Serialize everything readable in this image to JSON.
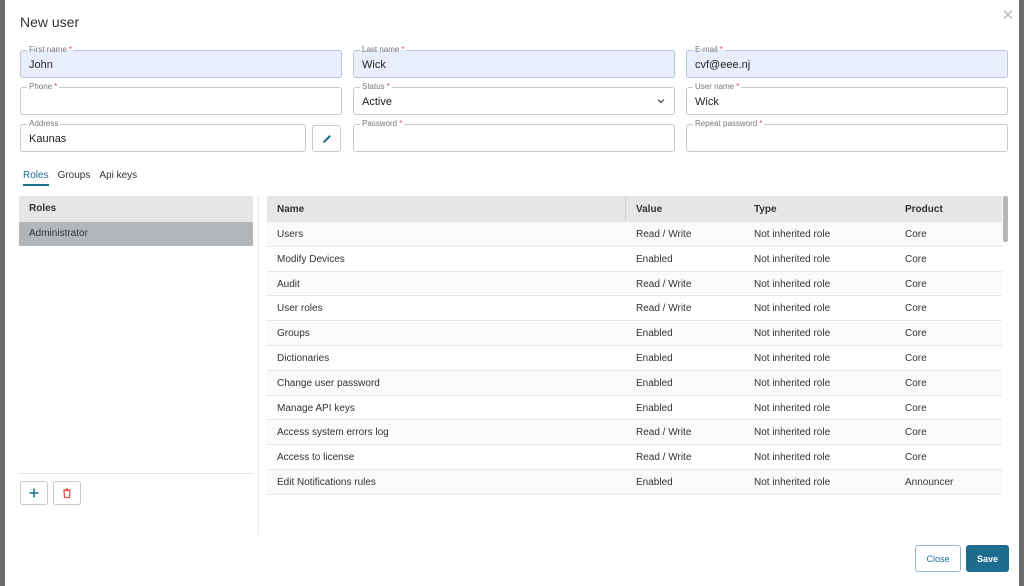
{
  "dialog": {
    "title": "New user"
  },
  "fields": {
    "first_name": {
      "label": "First name",
      "required": "*",
      "value": "John"
    },
    "last_name": {
      "label": "Last name",
      "required": "*",
      "value": "Wick"
    },
    "email": {
      "label": "E-mail",
      "required": "*",
      "value": "cvf@eee.nj"
    },
    "phone": {
      "label": "Phone",
      "required": "*",
      "value": ""
    },
    "status": {
      "label": "Status",
      "required": "*",
      "value": "Active"
    },
    "user_name": {
      "label": "User name",
      "required": "*",
      "value": "Wick"
    },
    "address": {
      "label": "Address",
      "value": "Kaunas"
    },
    "password": {
      "label": "Password",
      "required": "*",
      "value": ""
    },
    "repeat_password": {
      "label": "Repeat password",
      "required": "*",
      "value": ""
    }
  },
  "tabs": [
    {
      "label": "Roles",
      "active": true
    },
    {
      "label": "Groups",
      "active": false
    },
    {
      "label": "Api keys",
      "active": false
    }
  ],
  "roles_panel": {
    "header": "Roles",
    "items": [
      "Administrator"
    ]
  },
  "permissions_table": {
    "columns": [
      "Name",
      "Value",
      "Type",
      "Product"
    ],
    "rows": [
      [
        "Users",
        "Read / Write",
        "Not inherited role",
        "Core"
      ],
      [
        "Modify Devices",
        "Enabled",
        "Not inherited role",
        "Core"
      ],
      [
        "Audit",
        "Read / Write",
        "Not inherited role",
        "Core"
      ],
      [
        "User roles",
        "Read / Write",
        "Not inherited role",
        "Core"
      ],
      [
        "Groups",
        "Enabled",
        "Not inherited role",
        "Core"
      ],
      [
        "Dictionaries",
        "Enabled",
        "Not inherited role",
        "Core"
      ],
      [
        "Change user password",
        "Enabled",
        "Not inherited role",
        "Core"
      ],
      [
        "Manage API keys",
        "Enabled",
        "Not inherited role",
        "Core"
      ],
      [
        "Access system errors log",
        "Read / Write",
        "Not inherited role",
        "Core"
      ],
      [
        "Access to license",
        "Read / Write",
        "Not inherited role",
        "Core"
      ],
      [
        "Edit Notifications rules",
        "Enabled",
        "Not inherited role",
        "Announcer"
      ]
    ]
  },
  "footer": {
    "close_label": "Close",
    "save_label": "Save"
  },
  "colors": {
    "accent": "#1c6d8e",
    "filled_field": "#e8eefb",
    "selected_row": "#b3b6b8"
  }
}
